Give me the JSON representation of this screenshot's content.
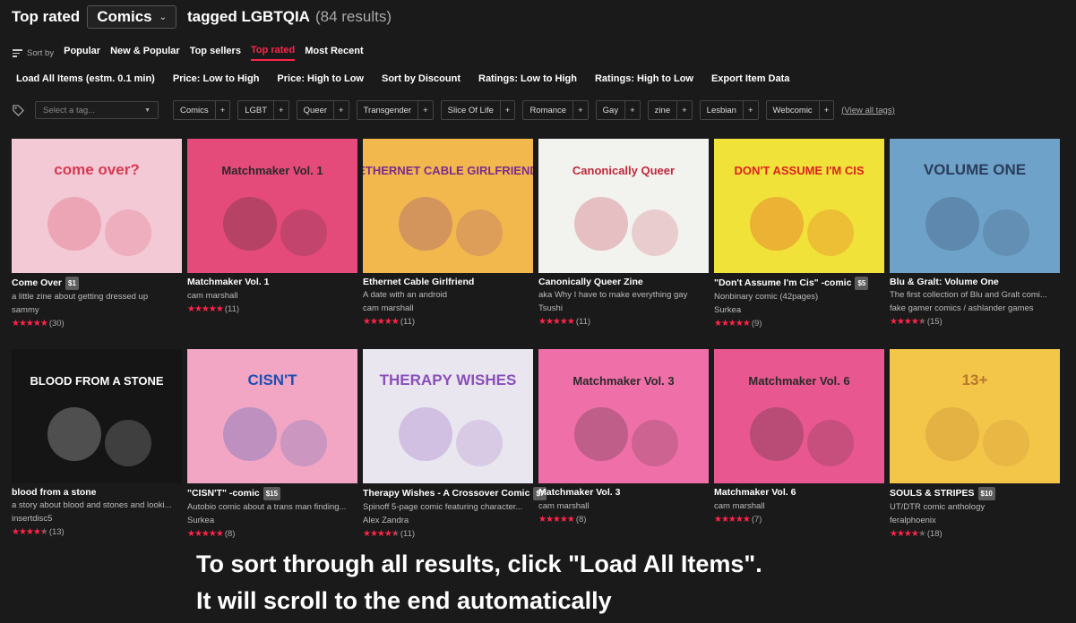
{
  "header": {
    "prefix": "Top rated",
    "category": "Comics",
    "tagged": "tagged LGBTQIA",
    "count": "(84 results)"
  },
  "sort": {
    "label": "Sort by",
    "tabs": [
      "Popular",
      "New & Popular",
      "Top sellers",
      "Top rated",
      "Most Recent"
    ],
    "active": "Top rated"
  },
  "actions": [
    "Load All Items (estm. 0.1 min)",
    "Price: Low to High",
    "Price: High to Low",
    "Sort by Discount",
    "Ratings: Low to High",
    "Ratings: High to Low",
    "Export Item Data"
  ],
  "tags": {
    "placeholder": "Select a tag...",
    "chips": [
      "Comics",
      "LGBT",
      "Queer",
      "Transgender",
      "Slice Of Life",
      "Romance",
      "Gay",
      "zine",
      "Lesbian",
      "Webcomic"
    ],
    "plus": "+",
    "view_all": "(View all tags)"
  },
  "items": [
    {
      "title": "Come Over",
      "price": "$1",
      "desc": "a little zine about getting dressed up",
      "author": "sammy",
      "stars": 5,
      "count": "(30)",
      "bg": "#f3c9d6",
      "fg": "#d63a52",
      "cover_text": "come over?"
    },
    {
      "title": "Matchmaker Vol. 1",
      "price": "",
      "desc": "",
      "author": "cam marshall",
      "stars": 5,
      "count": "(11)",
      "bg": "#e44a7a",
      "fg": "#2a2a2a",
      "cover_text": "Matchmaker Vol. 1"
    },
    {
      "title": "Ethernet Cable Girlfriend",
      "price": "",
      "desc": "A date with an android",
      "author": "cam marshall",
      "stars": 5,
      "count": "(11)",
      "bg": "#f2b84d",
      "fg": "#7c2b8c",
      "cover_text": "ETHERNET CABLE GIRLFRIEND"
    },
    {
      "title": "Canonically Queer Zine",
      "price": "",
      "desc": "aka Why I have to make everything gay",
      "author": "Tsushi",
      "stars": 5,
      "count": "(11)",
      "bg": "#f2f2ee",
      "fg": "#c0283c",
      "cover_text": "Canonically Queer"
    },
    {
      "title": "\"Don't Assume I'm Cis\" -comic",
      "price": "$5",
      "desc": "Nonbinary comic (42pages)",
      "author": "Surkea",
      "stars": 5,
      "count": "(9)",
      "bg": "#f1e23a",
      "fg": "#d22",
      "cover_text": "DON'T ASSUME I'M CIS"
    },
    {
      "title": "Blu & Gralt: Volume One",
      "price": "",
      "desc": "The first collection of Blu and Gralt comi...",
      "author": "fake gamer comics / ashlander games",
      "stars": 4.5,
      "count": "(15)",
      "bg": "#6fa2c9",
      "fg": "#2a3d5c",
      "cover_text": "VOLUME ONE"
    },
    {
      "title": "blood from a stone",
      "price": "",
      "desc": "a story about blood and stones and looki...",
      "author": "insertdisc5",
      "stars": 4.5,
      "count": "(13)",
      "bg": "#151515",
      "fg": "#ffffff",
      "cover_text": "BLOOD FROM A STONE"
    },
    {
      "title": "\"CISN'T\" -comic",
      "price": "$15",
      "desc": "Autobio comic about a trans man finding...",
      "author": "Surkea",
      "stars": 5,
      "count": "(8)",
      "bg": "#f2a6c4",
      "fg": "#1e4fb0",
      "cover_text": "CISN'T"
    },
    {
      "title": "Therapy Wishes - A Crossover Comic",
      "price": "$7",
      "desc": "Spinoff 5-page comic featuring character...",
      "author": "Alex Zandra",
      "stars": 4.5,
      "count": "(11)",
      "bg": "#e9e6ef",
      "fg": "#8a4fb8",
      "cover_text": "THERAPY WISHES"
    },
    {
      "title": "Matchmaker Vol. 3",
      "price": "",
      "desc": "",
      "author": "cam marshall",
      "stars": 5,
      "count": "(8)",
      "bg": "#ef6fa8",
      "fg": "#2a2a2a",
      "cover_text": "Matchmaker Vol. 3"
    },
    {
      "title": "Matchmaker Vol. 6",
      "price": "",
      "desc": "",
      "author": "cam marshall",
      "stars": 5,
      "count": "(7)",
      "bg": "#e8578f",
      "fg": "#2a2a2a",
      "cover_text": "Matchmaker Vol. 6"
    },
    {
      "title": "SOULS & STRIPES",
      "price": "$10",
      "desc": "UT/DTR comic anthology",
      "author": "feralphoenix",
      "stars": 4,
      "count": "(18)",
      "bg": "#f3c64a",
      "fg": "#b8762a",
      "cover_text": "13+"
    }
  ],
  "overlay": {
    "line1": "To sort through all results, click \"Load All Items\".",
    "line2": "It will scroll to the end automatically"
  },
  "colors": {
    "accent": "#ff2449",
    "bg": "#1a1a1a"
  }
}
